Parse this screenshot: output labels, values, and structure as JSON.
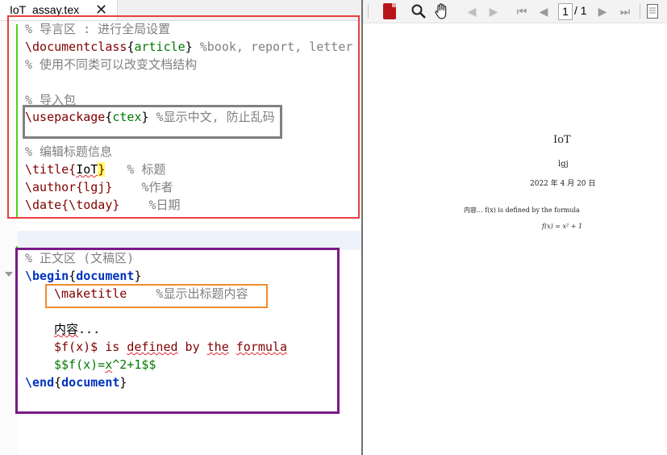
{
  "tab": {
    "title": "IoT_assay.tex",
    "close": "✕"
  },
  "code": {
    "l1": "% 导言区 : 进行全局设置",
    "l2": {
      "cmd": "\\documentclass",
      "ob": "{",
      "arg": "article",
      "cb": "}",
      "comment": " %book, report, letter"
    },
    "l3": "% 使用不同类可以改变文档结构",
    "l4": "% 导入包",
    "l5": {
      "cmd": "\\usepackage",
      "ob": "{",
      "arg": "ctex",
      "cb": "}",
      "comment": " %显示中文, 防止乱码"
    },
    "l6": "% 编辑标题信息",
    "l7": {
      "cmd": "\\title{",
      "arg": "IoT",
      "cb": "}",
      "comment": "   % 标题"
    },
    "l8": {
      "cmd": "\\author{lgj}",
      "comment": "    %作者"
    },
    "l9": {
      "cmd": "\\date{\\today}",
      "comment": "    %日期"
    },
    "l10": "% 正文区 (文稿区)",
    "l11": {
      "kw": "\\begin",
      "ob": "{",
      "arg": "document",
      "cb": "}"
    },
    "l12": {
      "cmd": "\\maketitle",
      "comment": "    %显示出标题内容"
    },
    "l13": {
      "a": "内容",
      "b": "..."
    },
    "l14": {
      "a": "$f(x)$ is ",
      "b": "defined",
      "c": " by ",
      "d": "the",
      "e": " ",
      "f": "formula"
    },
    "l15": {
      "a": "$$f(x)=",
      "b": "x",
      "c": "^2+1$$"
    },
    "l16": {
      "kw": "\\end",
      "ob": "{",
      "arg": "document",
      "cb": "}"
    }
  },
  "viewer": {
    "page_current": "1",
    "page_total": "/ 1",
    "doc_title": "IoT",
    "doc_author": "lgj",
    "doc_date": "2022 年 4 月 20 日",
    "doc_body": "内容... f(x) is defined by the formula",
    "doc_formula": "f(x) = x² + 1"
  },
  "colors": {
    "box_red": "#e84040",
    "box_gray": "#808080",
    "box_purple": "#7a1a86",
    "box_orange": "#f08a30",
    "change_bar": "#4cd21f",
    "cmd": "#800000",
    "arg": "#007a00",
    "keyword": "#0033bb",
    "comment": "#808080"
  }
}
